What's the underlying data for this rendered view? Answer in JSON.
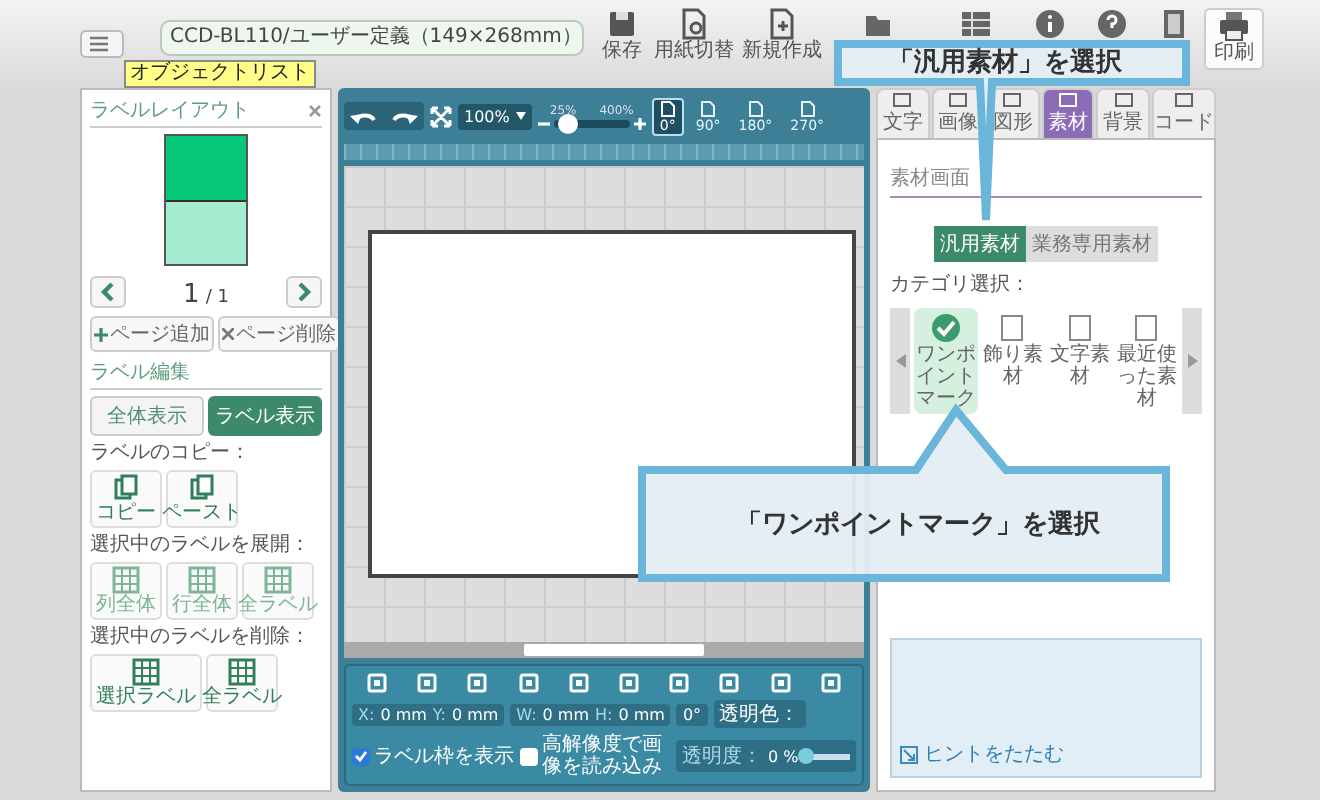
{
  "tooltip": "オブジェクトリスト",
  "title_field": {
    "value": "CCD-BL110/ユーザー定義（149×268mm）"
  },
  "toolbar": [
    {
      "label": "保存"
    },
    {
      "label": "用紙切替"
    },
    {
      "label": "新規作成"
    },
    {
      "label": "印刷"
    }
  ],
  "layout_panel": {
    "title": "ラベルレイアウト",
    "page": "1",
    "page_total": "/ 1",
    "buttons": [
      "ページ追加",
      "ページ削除"
    ]
  },
  "edit_panel": {
    "title": "ラベル編集",
    "view_toggle": [
      {
        "label": "全体表示",
        "selected": false
      },
      {
        "label": "ラベル表示",
        "selected": true
      }
    ],
    "groups": [
      {
        "label": "ラベルのコピー：",
        "buttons": [
          {
            "label": "コピー",
            "disabled": false
          },
          {
            "label": "ペースト",
            "disabled": false
          }
        ]
      },
      {
        "label": "選択中のラベルを展開：",
        "buttons": [
          {
            "label": "列全体",
            "disabled": true
          },
          {
            "label": "行全体",
            "disabled": true
          },
          {
            "label": "全ラベル",
            "disabled": true
          }
        ]
      },
      {
        "label": "選択中のラベルを削除：",
        "buttons": [
          {
            "label": "選択ラベル",
            "disabled": false
          },
          {
            "label": "全ラベル",
            "disabled": false
          }
        ]
      }
    ]
  },
  "canvas_toolbar": {
    "zoom": "100%",
    "zoom_min": "25%",
    "zoom_max": "400%",
    "zoom_slider": {
      "level": 0.2
    },
    "rotations": [
      {
        "label": "0°",
        "selected": true
      },
      {
        "label": "90°",
        "selected": false
      },
      {
        "label": "180°",
        "selected": false
      },
      {
        "label": "270°",
        "selected": false
      }
    ]
  },
  "properties": {
    "fields": [
      {
        "label": "X:",
        "value": "0 mm"
      },
      {
        "label": "Y:",
        "value": "0 mm"
      },
      {
        "label": "W:",
        "value": "0 mm"
      },
      {
        "label": "H:",
        "value": "0 mm"
      }
    ],
    "angle": "0°",
    "transparent_color": "透明色：",
    "show_frame": {
      "label": "ラベル枠を表示",
      "checked": true
    },
    "high_res": {
      "label": "高解像度で画像を読み込み",
      "checked": false
    },
    "opacity": {
      "label": "透明度：",
      "value": "0 %",
      "level": 0.05
    }
  },
  "right_panel": {
    "tabs": [
      {
        "label": "文字",
        "selected": false
      },
      {
        "label": "画像",
        "selected": false
      },
      {
        "label": "図形",
        "selected": false
      },
      {
        "label": "素材",
        "selected": true
      },
      {
        "label": "背景",
        "selected": false
      },
      {
        "label": "コード",
        "selected": false
      }
    ],
    "section_title": "素材画面",
    "material_types": [
      {
        "label": "汎用素材",
        "selected": true
      },
      {
        "label": "業務専用素材",
        "selected": false
      }
    ],
    "category_label": "カテゴリ選択：",
    "categories": [
      {
        "label": "ワンポイントマーク",
        "selected": true
      },
      {
        "label": "飾り素材",
        "selected": false
      },
      {
        "label": "文字素材",
        "selected": false
      },
      {
        "label": "最近使った素材",
        "selected": false
      }
    ],
    "hint_toggle": "ヒントをたたむ"
  },
  "callouts": [
    {
      "text": "「汎用素材」を選択"
    },
    {
      "text": "「ワンポイントマーク」を選択"
    }
  ]
}
